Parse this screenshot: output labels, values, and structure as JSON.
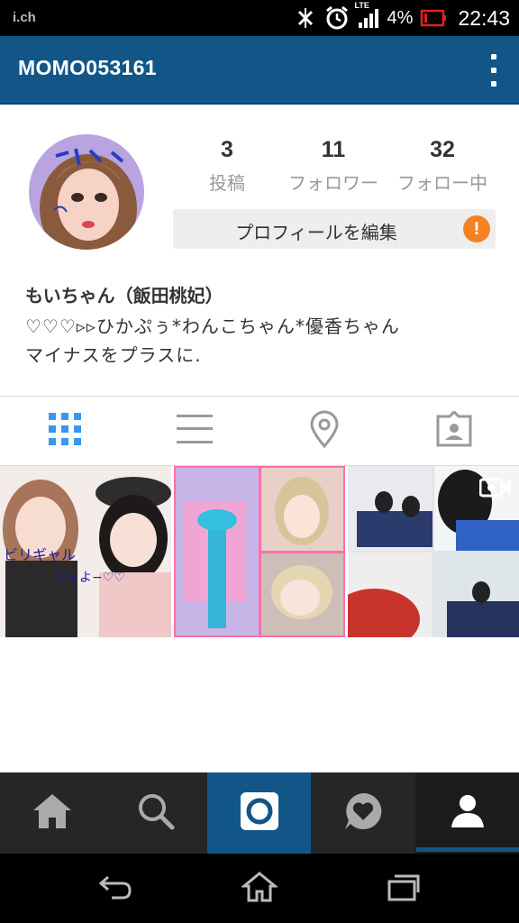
{
  "status_bar": {
    "carrier": "i.ch",
    "network": "LTE",
    "battery_percent": "4%",
    "time": "22:43",
    "icons": [
      "bluetooth-off-icon",
      "alarm-icon",
      "signal-icon",
      "battery-low-icon"
    ]
  },
  "app_bar": {
    "title": "MOMO053161",
    "menu_icon": "overflow-menu-icon"
  },
  "profile": {
    "stats": [
      {
        "count": "3",
        "label": "投稿"
      },
      {
        "count": "11",
        "label": "フォロワー"
      },
      {
        "count": "32",
        "label": "フォロー中"
      }
    ],
    "edit_button_label": "プロフィールを編集",
    "warning_glyph": "!",
    "name": "もいちゃん（飯田桃妃）",
    "bio_line_1": "♡♡♡▹▹ひかぷぅ*わんこちゃん*優香ちゃん",
    "bio_line_2": "マイナスをプラスに."
  },
  "view_tabs": [
    {
      "icon": "grid-view-icon",
      "active": true
    },
    {
      "icon": "list-view-icon",
      "active": false
    },
    {
      "icon": "location-pin-icon",
      "active": false
    },
    {
      "icon": "tagged-photos-icon",
      "active": false
    }
  ],
  "posts": [
    {
      "kind": "photo"
    },
    {
      "kind": "photo"
    },
    {
      "kind": "video",
      "badge_icon": "video-camera-icon"
    }
  ],
  "bottom_nav": [
    {
      "icon": "home-icon",
      "active": false
    },
    {
      "icon": "search-icon",
      "active": false
    },
    {
      "icon": "camera-icon",
      "active": true
    },
    {
      "icon": "activity-heart-icon",
      "active": false
    },
    {
      "icon": "profile-icon",
      "active": true
    }
  ],
  "system_nav": [
    "back-icon",
    "home-outline-icon",
    "recent-apps-icon"
  ],
  "colors": {
    "brand_blue": "#125688",
    "tab_active_blue": "#3897f0",
    "warning_orange": "#f58220",
    "nav_dark": "#262626"
  }
}
